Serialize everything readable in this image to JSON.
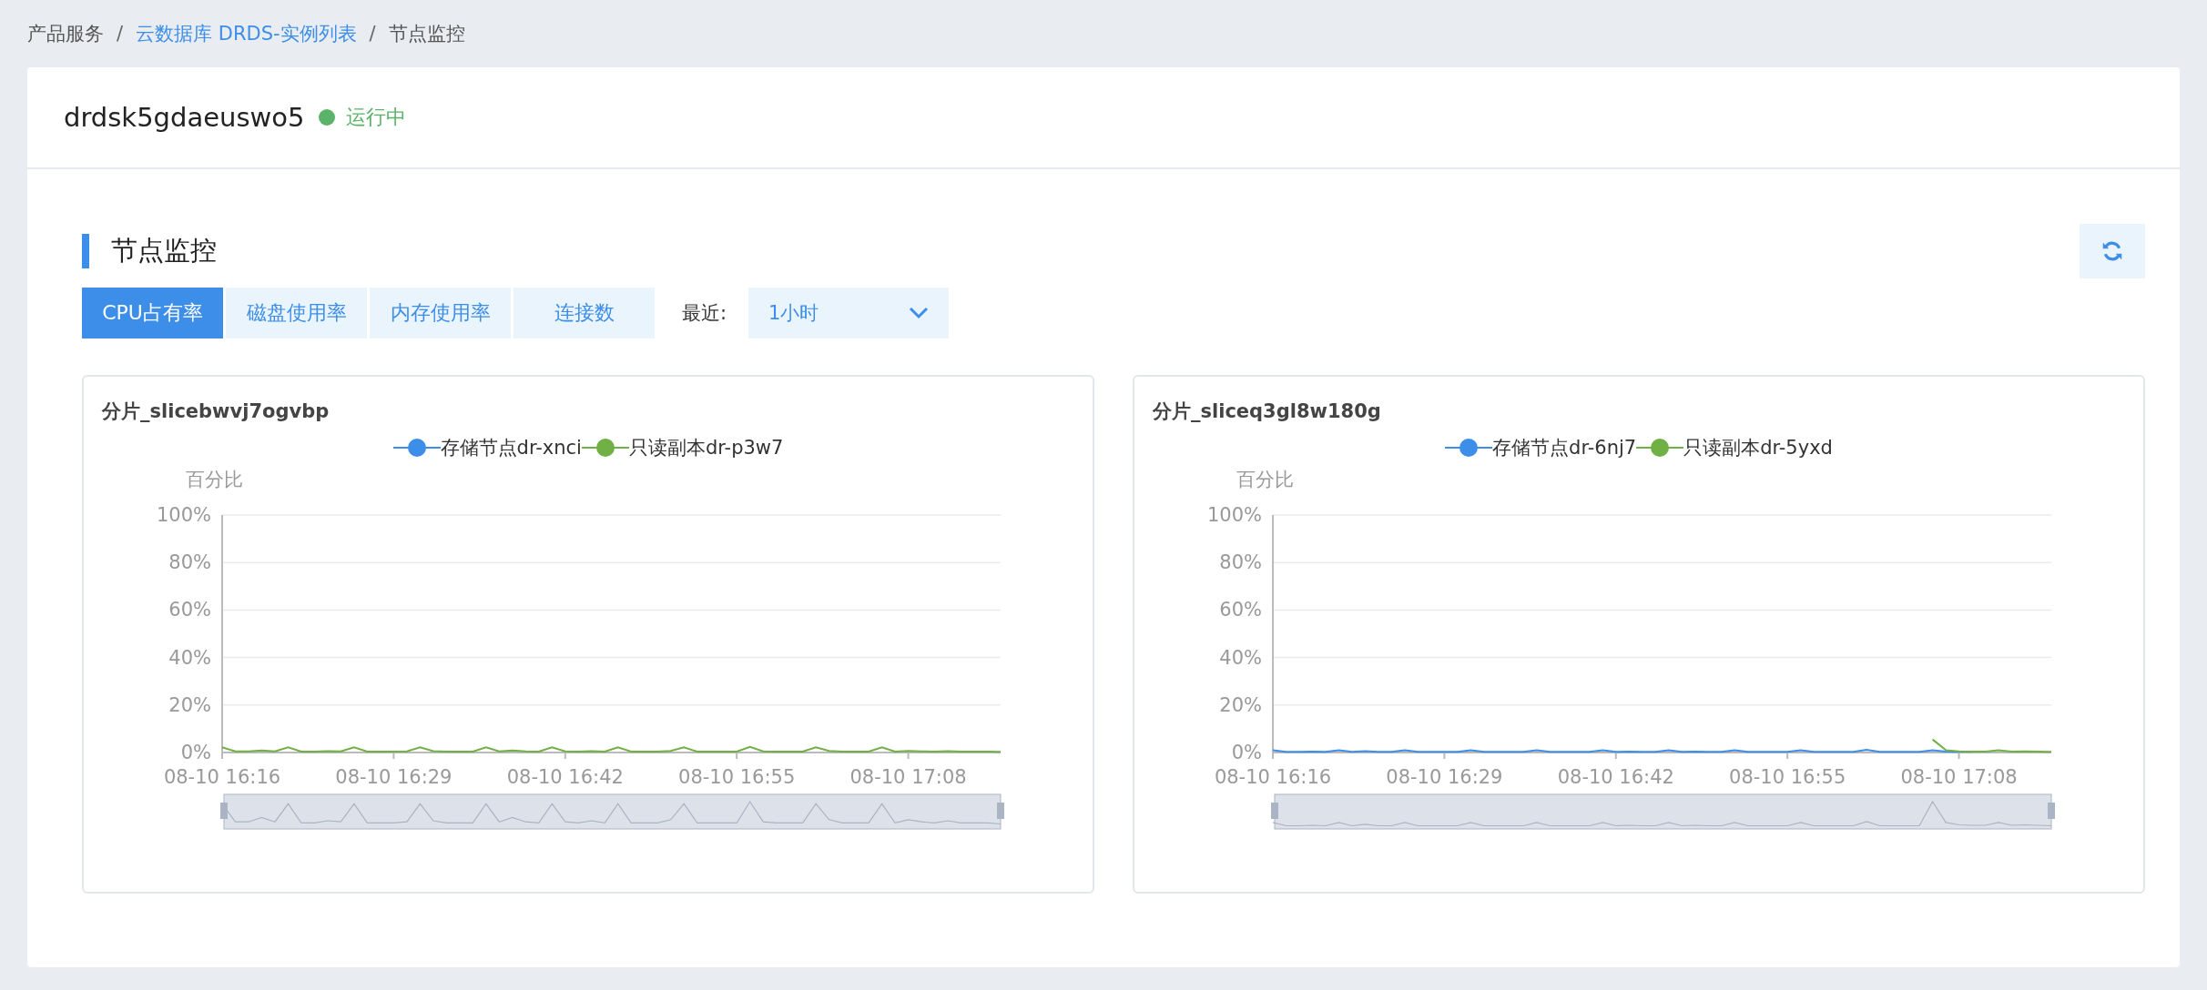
{
  "breadcrumb": [
    {
      "kind": "text",
      "label": "产品服务"
    },
    {
      "kind": "separator",
      "label": "/"
    },
    {
      "kind": "link",
      "label": "云数据库 DRDS-实例列表"
    },
    {
      "kind": "separator",
      "label": "/"
    },
    {
      "kind": "text",
      "label": "节点监控"
    }
  ],
  "instance": {
    "name": "drdsk5gdaeuswo5",
    "status": "运行中"
  },
  "section": {
    "title": "节点监控"
  },
  "tabs": [
    {
      "label": "CPU占有率",
      "selected": true
    },
    {
      "label": "磁盘使用率",
      "selected": false
    },
    {
      "label": "内存使用率",
      "selected": false
    },
    {
      "label": "连接数",
      "selected": false
    }
  ],
  "range": {
    "label": "最近:",
    "value": "1小时"
  },
  "charts": [
    {
      "title": "分片_slicebwvj7ogvbp",
      "chart_data": {
        "type": "line",
        "grid": true,
        "ylabel": "百分比",
        "categories": [
          "08-10 16:16",
          null,
          null,
          null,
          null,
          null,
          null,
          null,
          null,
          null,
          null,
          null,
          null,
          "08-10 16:29",
          null,
          null,
          null,
          null,
          null,
          null,
          null,
          null,
          null,
          null,
          null,
          null,
          "08-10 16:42",
          null,
          null,
          null,
          null,
          null,
          null,
          null,
          null,
          null,
          null,
          null,
          null,
          "08-10 16:55",
          null,
          null,
          null,
          null,
          null,
          null,
          null,
          null,
          null,
          null,
          null,
          null,
          "08-10 17:08",
          null,
          null,
          null,
          null,
          null,
          null,
          null
        ],
        "ylim": [
          0,
          100
        ],
        "yticks": [
          {
            "value": 0,
            "label": "0%"
          },
          {
            "value": 20,
            "label": "20%"
          },
          {
            "value": 40,
            "label": "40%"
          },
          {
            "value": 60,
            "label": "60%"
          },
          {
            "value": 80,
            "label": "80%"
          },
          {
            "value": 100,
            "label": "100%"
          }
        ],
        "series": [
          {
            "name": "存储节点dr-xnci",
            "color": "#3d8ee8",
            "values": [
              null,
              null,
              null,
              null,
              null,
              null,
              null,
              null,
              null,
              null,
              null,
              null,
              null,
              null,
              null,
              null,
              null,
              null,
              null,
              null,
              null,
              null,
              null,
              null,
              null,
              null,
              null,
              null,
              null,
              null,
              null,
              null,
              null,
              null,
              null,
              null,
              null,
              null,
              null,
              null,
              null,
              null,
              null,
              null,
              null,
              null,
              null,
              null,
              null,
              null,
              null,
              null,
              null,
              null,
              null,
              null,
              null,
              null,
              null,
              null
            ]
          },
          {
            "name": "只读副本dr-p3w7",
            "color": "#70b045",
            "values": [
              2.2,
              0.5,
              0.5,
              0.9,
              0.5,
              2.2,
              0.4,
              0.4,
              0.6,
              0.5,
              2.2,
              0.4,
              0.4,
              0.4,
              0.5,
              2.2,
              0.6,
              0.4,
              0.4,
              0.4,
              2.2,
              0.5,
              0.9,
              0.5,
              0.4,
              2.2,
              0.5,
              0.4,
              0.6,
              0.4,
              2.2,
              0.4,
              0.4,
              0.4,
              0.7,
              2.2,
              0.4,
              0.4,
              0.4,
              0.4,
              2.4,
              0.5,
              0.4,
              0.4,
              0.4,
              2.2,
              0.7,
              0.4,
              0.4,
              0.4,
              2.2,
              0.4,
              0.7,
              0.5,
              0.4,
              0.6,
              0.4,
              0.4,
              0.4,
              0.3
            ]
          }
        ]
      }
    },
    {
      "title": "分片_sliceq3gl8w180g",
      "chart_data": {
        "type": "line",
        "grid": true,
        "ylabel": "百分比",
        "categories": [
          "08-10 16:16",
          null,
          null,
          null,
          null,
          null,
          null,
          null,
          null,
          null,
          null,
          null,
          null,
          "08-10 16:29",
          null,
          null,
          null,
          null,
          null,
          null,
          null,
          null,
          null,
          null,
          null,
          null,
          "08-10 16:42",
          null,
          null,
          null,
          null,
          null,
          null,
          null,
          null,
          null,
          null,
          null,
          null,
          "08-10 16:55",
          null,
          null,
          null,
          null,
          null,
          null,
          null,
          null,
          null,
          null,
          null,
          null,
          "08-10 17:08",
          null,
          null,
          null,
          null,
          null,
          null,
          null
        ],
        "ylim": [
          0,
          100
        ],
        "yticks": [
          {
            "value": 0,
            "label": "0%"
          },
          {
            "value": 20,
            "label": "20%"
          },
          {
            "value": 40,
            "label": "40%"
          },
          {
            "value": 60,
            "label": "60%"
          },
          {
            "value": 80,
            "label": "80%"
          },
          {
            "value": 100,
            "label": "100%"
          }
        ],
        "series": [
          {
            "name": "存储节点dr-6nj7",
            "color": "#3d8ee8",
            "values": [
              1,
              0.3,
              0.3,
              0.4,
              0.3,
              1,
              0.3,
              0.6,
              0.3,
              0.3,
              1,
              0.3,
              0.3,
              0.3,
              0.3,
              1,
              0.3,
              0.3,
              0.3,
              0.3,
              1,
              0.3,
              0.3,
              0.3,
              0.3,
              1,
              0.3,
              0.4,
              0.3,
              0.3,
              1,
              0.3,
              0.4,
              0.3,
              0.3,
              1,
              0.3,
              0.3,
              0.3,
              0.3,
              1,
              0.3,
              0.3,
              0.3,
              0.3,
              1.2,
              0.3,
              0.3,
              0.3,
              0.3,
              1,
              0.4,
              0.3,
              0.3,
              null,
              null,
              null,
              null,
              null,
              null
            ]
          },
          {
            "name": "只读副本dr-5yxd",
            "color": "#70b045",
            "values": [
              null,
              null,
              null,
              null,
              null,
              null,
              null,
              null,
              null,
              null,
              null,
              null,
              null,
              null,
              null,
              null,
              null,
              null,
              null,
              null,
              null,
              null,
              null,
              null,
              null,
              null,
              null,
              null,
              null,
              null,
              null,
              null,
              null,
              null,
              null,
              null,
              null,
              null,
              null,
              null,
              null,
              null,
              null,
              null,
              null,
              null,
              null,
              null,
              null,
              null,
              5.5,
              1,
              0.5,
              0.4,
              0.4,
              1,
              0.4,
              0.5,
              0.4,
              0.3
            ]
          }
        ]
      }
    }
  ]
}
